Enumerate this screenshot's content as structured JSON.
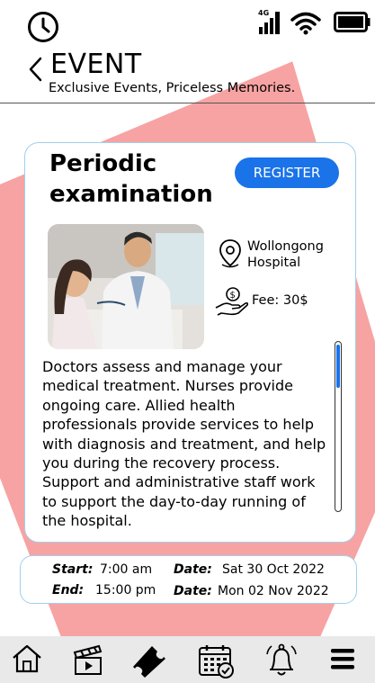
{
  "header": {
    "title": "EVENT",
    "subtitle": "Exclusive Events, Priceless Memories."
  },
  "status_bar": {
    "network": "4G",
    "icons": [
      "clock-icon",
      "signal-icon",
      "wifi-icon",
      "battery-icon"
    ]
  },
  "event": {
    "title": "Periodic examination",
    "register_label": "REGISTER",
    "location_line1": "Wollongong",
    "location_line2": "Hospital",
    "fee": "Fee: 30$",
    "description": "Doctors assess and manage your medical treatment. Nurses provide ongoing care. Allied health professionals provide services to help with diagnosis and treatment, and help you during the recovery process. Support and administrative staff work to support the day-to-day running of the hospital."
  },
  "schedule": {
    "start_label": "Start:",
    "start_time": "7:00 am",
    "end_label": "End:",
    "end_time": "15:00 pm",
    "start_date_label": "Date:",
    "start_date": "Sat 30 Oct 2022",
    "end_date_label": "Date:",
    "end_date": "Mon 02 Nov 2022"
  },
  "bottom_nav": {
    "items": [
      "home-icon",
      "clapperboard-icon",
      "ticket-icon",
      "calendar-icon",
      "bell-icon",
      "menu-icon"
    ],
    "active": "ticket-icon"
  },
  "colors": {
    "accent": "#1a73e8",
    "background_shape": "#f7a3a3",
    "card_border": "#9fd0ee"
  }
}
